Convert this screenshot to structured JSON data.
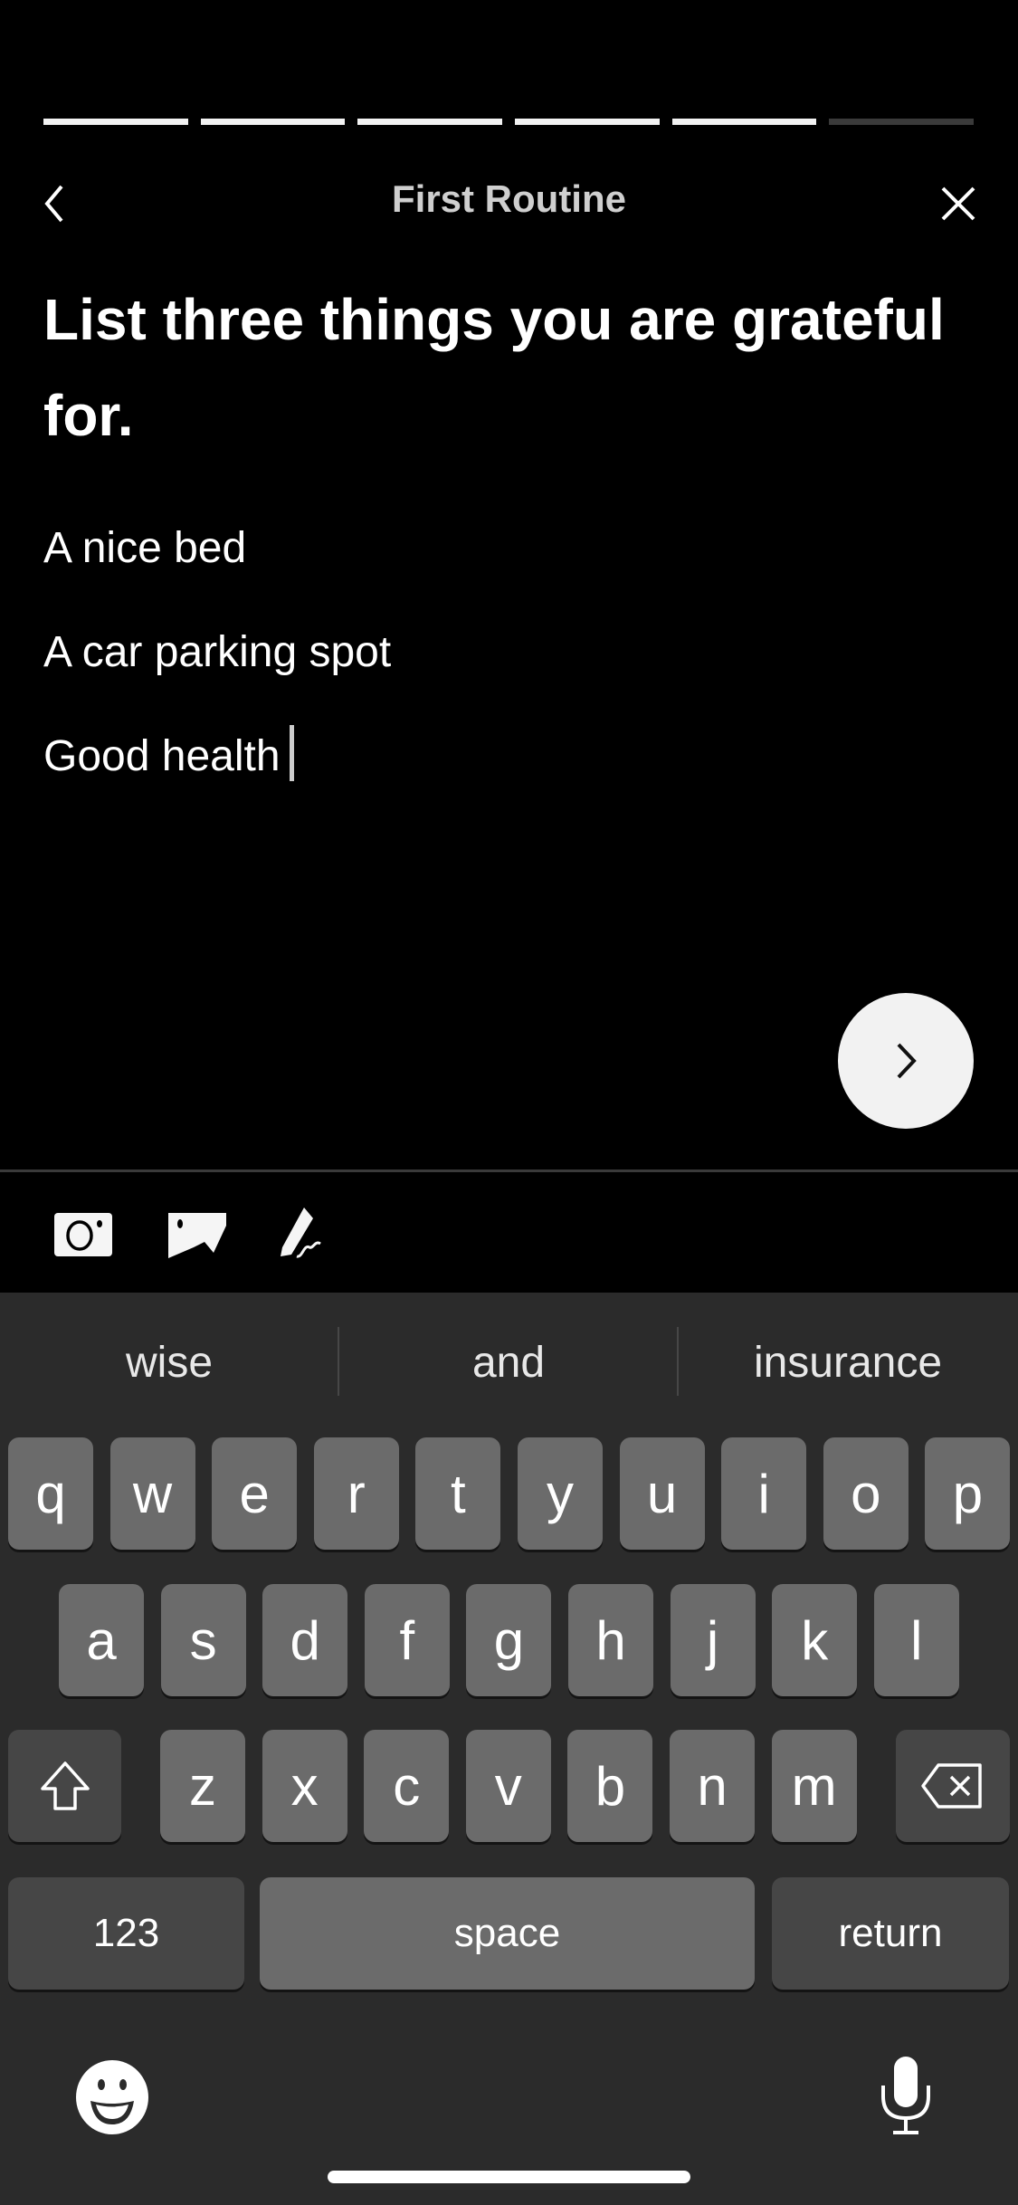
{
  "progress": {
    "total_steps": 6,
    "completed_steps": 5
  },
  "header": {
    "title": "First Routine",
    "back_icon": "chevron-left-icon",
    "close_icon": "close-icon"
  },
  "prompt": {
    "heading": "List three things you are grateful for."
  },
  "entries": [
    "A nice bed",
    "A car parking spot",
    "Good health"
  ],
  "toolbar": {
    "icons": [
      "camera-icon",
      "image-icon",
      "signature-pen-icon"
    ]
  },
  "keyboard": {
    "suggestions": [
      "wise",
      "and",
      "insurance"
    ],
    "row1": [
      "q",
      "w",
      "e",
      "r",
      "t",
      "y",
      "u",
      "i",
      "o",
      "p"
    ],
    "row2": [
      "a",
      "s",
      "d",
      "f",
      "g",
      "h",
      "j",
      "k",
      "l"
    ],
    "row3": [
      "z",
      "x",
      "c",
      "v",
      "b",
      "n",
      "m"
    ],
    "numbers_label": "123",
    "space_label": "space",
    "return_label": "return",
    "colors": {
      "background": "#2b2b2b",
      "key": "#6b6b6b",
      "special_key": "#464646"
    }
  }
}
